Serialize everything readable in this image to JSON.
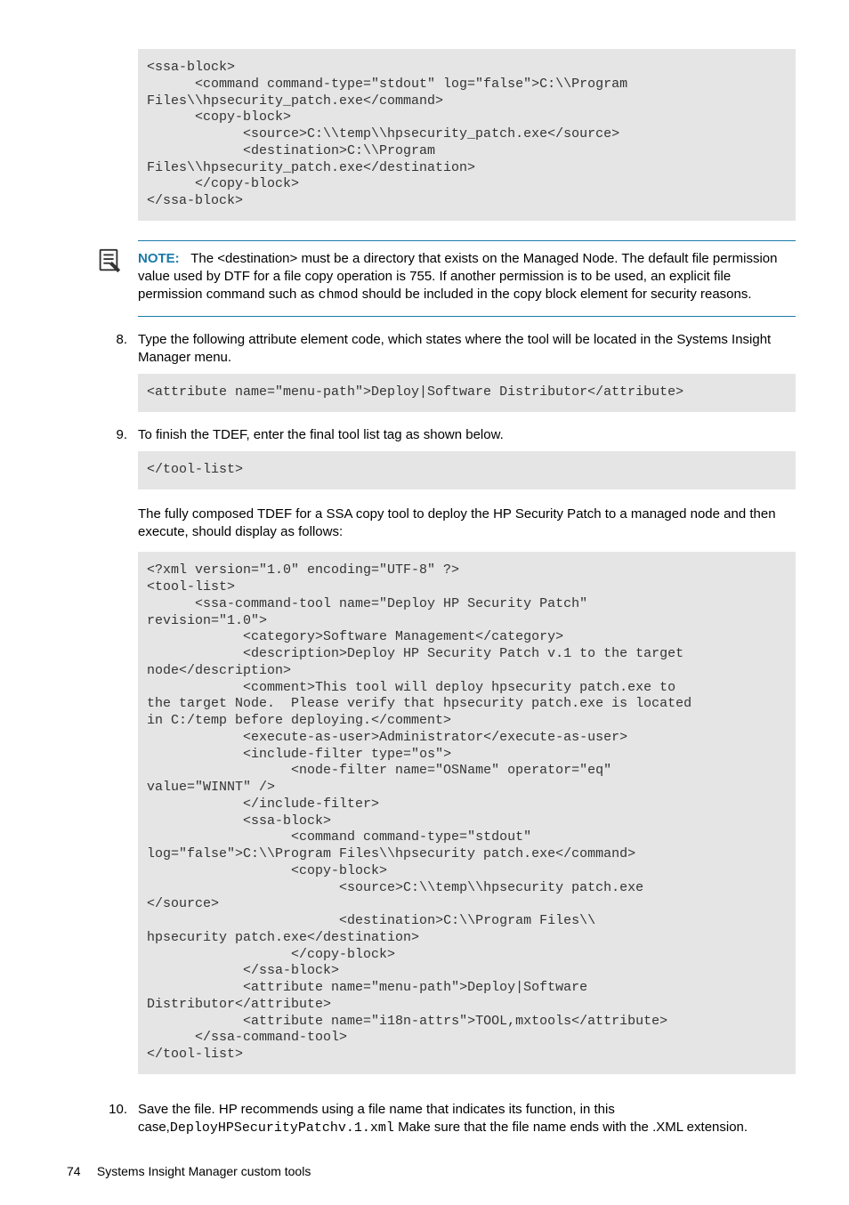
{
  "code1": "<ssa-block>\n      <command command-type=\"stdout\" log=\"false\">C:\\\\Program\nFiles\\\\hpsecurity_patch.exe</command>\n      <copy-block>\n            <source>C:\\\\temp\\\\hpsecurity_patch.exe</source>\n            <destination>C:\\\\Program\nFiles\\\\hpsecurity_patch.exe</destination>\n      </copy-block>\n</ssa-block>",
  "note": {
    "label": "NOTE:",
    "text_part1": "The <destination> must be a directory that exists on the Managed Node. The default file permission value used by DTF for a file copy operation is 755. If another permission is to be used, an explicit file permission command such as ",
    "chmod": "chmod",
    "text_part2": " should be included in the copy block element for security reasons."
  },
  "step8": {
    "num": "8.",
    "text": "Type the following attribute element code, which states where the tool will be located in the Systems Insight Manager menu."
  },
  "code2": "<attribute name=\"menu-path\">Deploy|Software Distributor</attribute>",
  "step9": {
    "num": "9.",
    "text": "To finish the TDEF, enter the final tool list tag as shown below."
  },
  "code3": "</tool-list>",
  "para1": "The fully composed TDEF for a SSA copy tool to deploy the HP Security Patch to a managed node and then execute, should display as follows:",
  "code4": "<?xml version=\"1.0\" encoding=\"UTF-8\" ?>\n<tool-list>\n      <ssa-command-tool name=\"Deploy HP Security Patch\"\nrevision=\"1.0\">\n            <category>Software Management</category>\n            <description>Deploy HP Security Patch v.1 to the target\nnode</description>\n            <comment>This tool will deploy hpsecurity patch.exe to\nthe target Node.  Please verify that hpsecurity patch.exe is located\nin C:/temp before deploying.</comment>\n            <execute-as-user>Administrator</execute-as-user>\n            <include-filter type=\"os\">\n                  <node-filter name=\"OSName\" operator=\"eq\"\nvalue=\"WINNT\" />\n            </include-filter>\n            <ssa-block>\n                  <command command-type=\"stdout\"\nlog=\"false\">C:\\\\Program Files\\\\hpsecurity patch.exe</command>\n                  <copy-block>\n                        <source>C:\\\\temp\\\\hpsecurity patch.exe\n</source>\n                        <destination>C:\\\\Program Files\\\\\nhpsecurity patch.exe</destination>\n                  </copy-block>\n            </ssa-block>\n            <attribute name=\"menu-path\">Deploy|Software\nDistributor</attribute>\n            <attribute name=\"i18n-attrs\">TOOL,mxtools</attribute>\n      </ssa-command-tool>\n</tool-list>",
  "step10": {
    "num": "10.",
    "text_a": "Save the file. HP recommends using a file name that indicates its function, in this case,",
    "fname": "DeployHPSecurityPatchv.1.xml",
    "text_b": " Make sure that the file name ends with the .XML extension."
  },
  "footer": {
    "pagenum": "74",
    "title": "Systems Insight Manager custom tools"
  }
}
